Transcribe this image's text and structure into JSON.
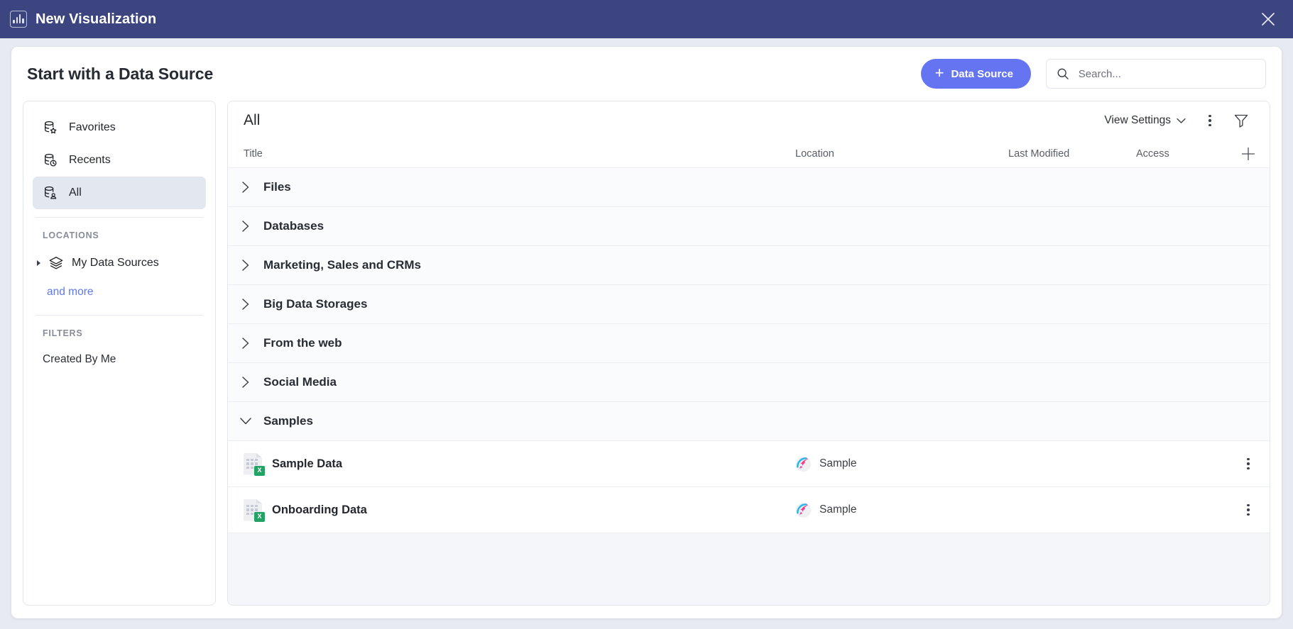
{
  "titlebar": {
    "app_title": "New Visualization",
    "logo_icon": "bar-chart-icon",
    "close_icon": "close-icon"
  },
  "dialog": {
    "heading": "Start with a Data Source",
    "primary_button": {
      "label": "Data Source",
      "icon": "plus-icon",
      "color": "#6574f0"
    },
    "search": {
      "placeholder": "Search...",
      "value": "",
      "icon": "search-icon"
    }
  },
  "sidebar": {
    "nav_items": [
      {
        "label": "Favorites",
        "icon": "database-star-icon",
        "active": false
      },
      {
        "label": "Recents",
        "icon": "database-clock-icon",
        "active": false
      },
      {
        "label": "All",
        "icon": "database-user-icon",
        "active": true
      }
    ],
    "locations_label": "LOCATIONS",
    "locations": [
      {
        "label": "My Data Sources",
        "icon": "layers-icon"
      }
    ],
    "more_link": "and more",
    "filters_label": "FILTERS",
    "filters": [
      {
        "label": "Created By Me"
      }
    ]
  },
  "content": {
    "title": "All",
    "view_settings_label": "View Settings",
    "view_settings_icon": "chevron-down-icon",
    "more_icon": "kebab-menu-icon",
    "filter_icon": "funnel-icon",
    "columns": {
      "title": "Title",
      "location": "Location",
      "last_modified": "Last Modified",
      "access": "Access",
      "add_icon": "plus-icon"
    },
    "groups": [
      {
        "label": "Files",
        "expanded": false
      },
      {
        "label": "Databases",
        "expanded": false
      },
      {
        "label": "Marketing, Sales and CRMs",
        "expanded": false
      },
      {
        "label": "Big Data Storages",
        "expanded": false
      },
      {
        "label": "From the web",
        "expanded": false
      },
      {
        "label": "Social Media",
        "expanded": false
      },
      {
        "label": "Samples",
        "expanded": true
      }
    ],
    "items": [
      {
        "title": "Sample Data",
        "file_icon": "excel-file-icon",
        "file_badge": "X",
        "location": "Sample",
        "location_icon": "rocket-icon",
        "last_modified": "",
        "access": "",
        "row_menu_icon": "kebab-menu-icon"
      },
      {
        "title": "Onboarding Data",
        "file_icon": "excel-file-icon",
        "file_badge": "X",
        "location": "Sample",
        "location_icon": "rocket-icon",
        "last_modified": "",
        "access": "",
        "row_menu_icon": "kebab-menu-icon"
      }
    ]
  }
}
